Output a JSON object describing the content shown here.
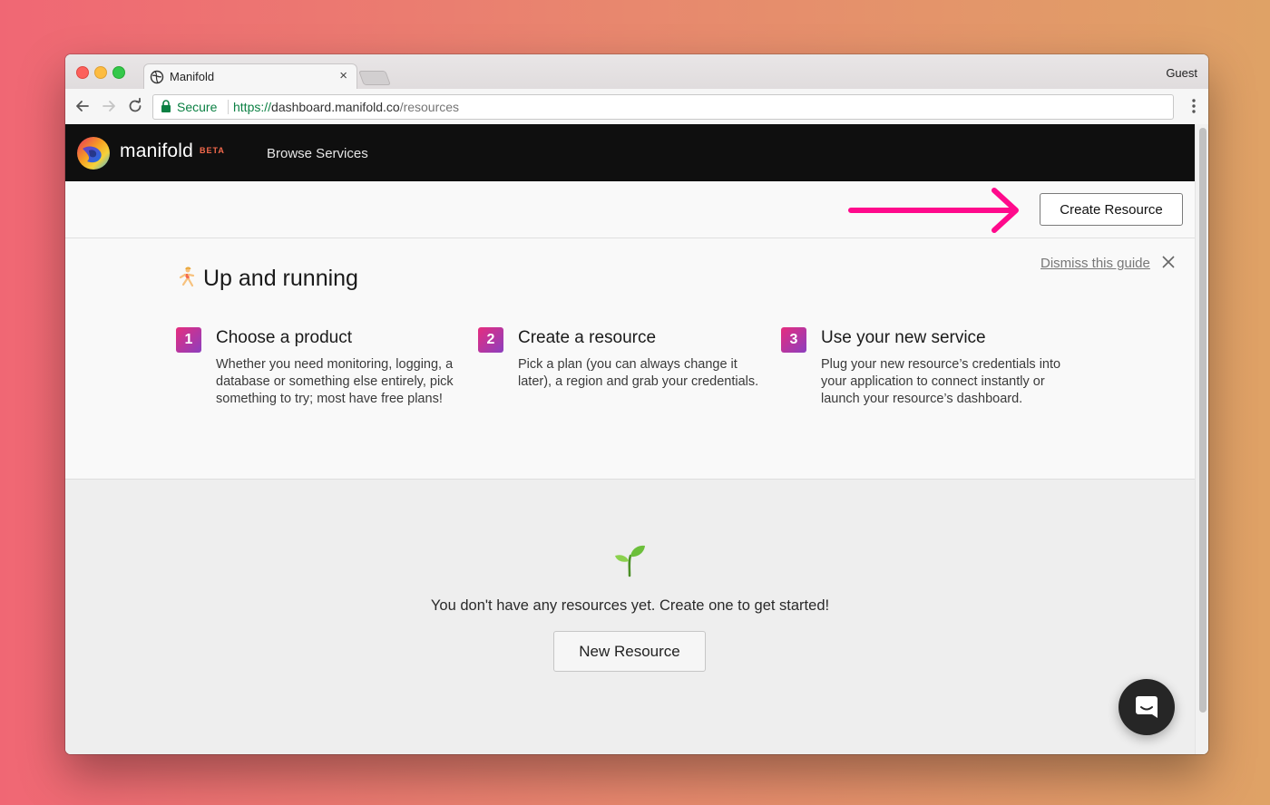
{
  "browser": {
    "tab_title": "Manifold",
    "tab_close": "×",
    "profile": "Guest",
    "secure_label": "Secure",
    "url_scheme": "https://",
    "url_host": "dashboard.manifold.co",
    "url_path": "/resources"
  },
  "app": {
    "brand": "manifold",
    "badge": "BETA",
    "nav": {
      "browse_label": "Browse Services"
    },
    "create_label": "Create Resource",
    "accent": "#ff0a8c"
  },
  "guide": {
    "title": "Up and running",
    "dismiss_label": "Dismiss this guide",
    "steps": [
      {
        "number": "1",
        "title": "Choose a product",
        "description": "Whether you need monitoring, logging, a database or something else entirely, pick something to try; most have free plans!"
      },
      {
        "number": "2",
        "title": "Create a resource",
        "description": "Pick a plan (you can always change it later), a region and grab your credentials."
      },
      {
        "number": "3",
        "title": "Use your new service",
        "description": "Plug your new resource’s credentials into your application to connect instantly or launch your resource’s dashboard."
      }
    ]
  },
  "empty_state": {
    "message": "You don't have any resources yet. Create one to get started!",
    "button_label": "New Resource"
  }
}
